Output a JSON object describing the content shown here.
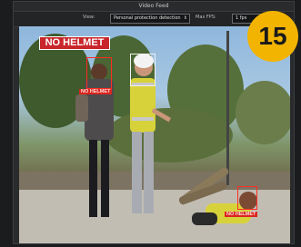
{
  "window": {
    "title": "Video Feed"
  },
  "toolbar": {
    "view_label": "View:",
    "view_value": "Personal protection detection",
    "fps_label": "Max FPS:",
    "fps_value": "1 fps"
  },
  "feed": {
    "alert_banner": "NO HELMET",
    "detections": [
      {
        "label": "NO HELMET",
        "status": "violation"
      },
      {
        "label": "",
        "status": "compliant"
      },
      {
        "label": "NO HELMET",
        "status": "violation"
      }
    ]
  },
  "badge": {
    "number": "15",
    "color": "#f2b400"
  },
  "colors": {
    "violation": "#ff2b22",
    "compliant": "#f2f2f2",
    "banner": "#c8262b"
  }
}
